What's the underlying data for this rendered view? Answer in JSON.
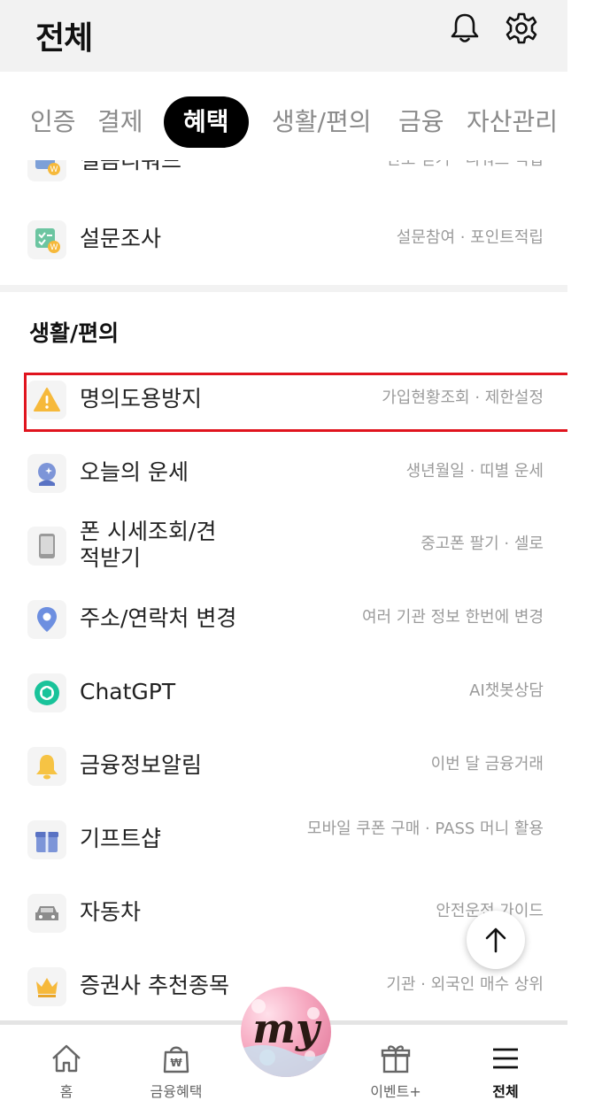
{
  "header": {
    "title": "전체",
    "bell_icon": "bell-icon",
    "settings_icon": "gear-icon"
  },
  "tabs": [
    {
      "label": "인증",
      "active": false
    },
    {
      "label": "결제",
      "active": false
    },
    {
      "label": "혜택",
      "active": true
    },
    {
      "label": "생활/편의",
      "active": false
    },
    {
      "label": "금융",
      "active": false
    },
    {
      "label": "자산관리",
      "active": false
    }
  ],
  "benefits_items": [
    {
      "label": "걸음리워드",
      "desc": "만보 걷기 · 리워드 적립",
      "icon": "steps-reward-icon"
    },
    {
      "label": "설문조사",
      "desc": "설문참여 · 포인트적립",
      "icon": "survey-icon"
    }
  ],
  "section_living": {
    "title": "생활/편의",
    "items": [
      {
        "label": "명의도용방지",
        "desc": "가입현황조회 · 제한설정",
        "icon": "warning-icon"
      },
      {
        "label": "오늘의 운세",
        "desc": "생년월일 · 띠별 운세",
        "icon": "crystal-ball-icon"
      },
      {
        "label": "폰 시세조회/견적받기",
        "desc": "중고폰 팔기 · 셀로",
        "icon": "phone-icon"
      },
      {
        "label": "주소/연락처 변경",
        "desc": "여러 기관 정보 한번에 변경",
        "icon": "location-pin-icon"
      },
      {
        "label": "ChatGPT",
        "desc": "AI챗봇상담",
        "icon": "chatgpt-icon"
      },
      {
        "label": "금융정보알림",
        "desc": "이번 달 금융거래",
        "icon": "bell-yellow-icon"
      },
      {
        "label": "기프트샵",
        "desc": "모바일 쿠폰 구매 · PASS 머니 활용",
        "icon": "gift-icon"
      },
      {
        "label": "자동차",
        "desc": "안전운전 가이드",
        "icon": "car-icon"
      },
      {
        "label": "증권사 추천종목",
        "desc": "기관 · 외국인 매수 상위",
        "icon": "crown-icon"
      }
    ]
  },
  "bottom_nav": [
    {
      "label": "홈",
      "icon": "home-icon",
      "active": false
    },
    {
      "label": "금융혜택",
      "icon": "shopping-bag-won-icon",
      "active": false
    },
    {
      "label": "my",
      "icon": "my-avatar-icon",
      "active": false
    },
    {
      "label": "이벤트+",
      "icon": "gift-outline-icon",
      "active": false
    },
    {
      "label": "전체",
      "icon": "menu-icon",
      "active": true
    }
  ],
  "colors": {
    "highlight": "#e0141e",
    "header_bg": "#f2f2f2",
    "active_tab_bg": "#000000"
  }
}
